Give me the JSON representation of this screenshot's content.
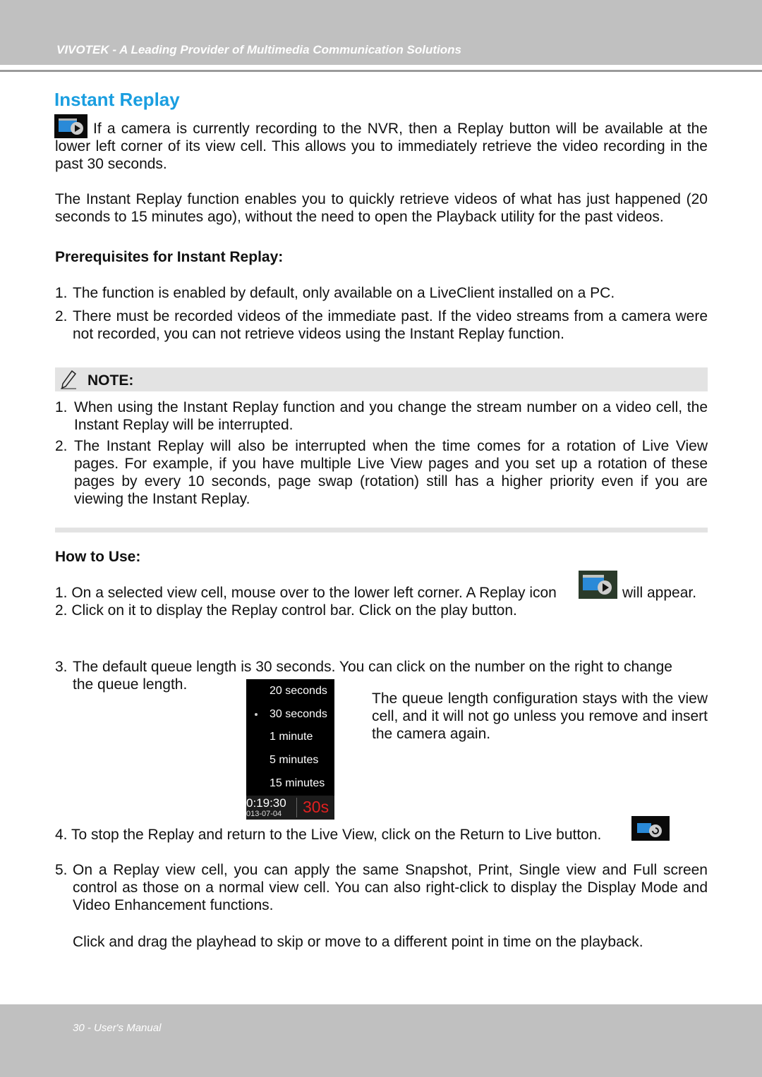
{
  "header": {
    "tagline": "VIVOTEK - A Leading Provider of Multimedia Communication Solutions"
  },
  "title": "Instant Replay",
  "intro": "If a camera is currently recording to the NVR, then a Replay button will be available at the lower left corner of its view cell. This allows you to immediately retrieve the video recording in the past 30 seconds.",
  "para2": "The Instant Replay function enables you to quickly retrieve videos of what has just happened (20 seconds to 15 minutes ago), without the need to open the Playback utility for the past videos.",
  "prereq": {
    "heading": "Prerequisites for Instant Replay:",
    "items": [
      {
        "n": "1.",
        "text": "The function is enabled by default, only available on a LiveClient installed on a PC."
      },
      {
        "n": "2.",
        "text": "There must be recorded videos of the immediate past. If the video streams from a camera were not recorded, you can not retrieve videos using the Instant Replay function."
      }
    ]
  },
  "note": {
    "label": "NOTE:",
    "items": [
      {
        "n": "1.",
        "text": "When using the Instant Replay function and you change the stream number on a video cell, the Instant Replay will be interrupted."
      },
      {
        "n": "2.",
        "text": "The Instant Replay will also be interrupted when the time comes for a rotation of Live View pages. For example, if you have multiple Live View pages and you set up a rotation of these pages by every 10 seconds, page swap (rotation) still has a higher priority even if you are viewing the Instant Replay."
      }
    ]
  },
  "howto": {
    "heading": "How to Use:",
    "step1a": "1. On a selected view cell, mouse over to the lower left corner. A Replay icon",
    "step1b": "will appear.",
    "step2": "2. Click on it to display the Replay control bar. Click on the play button.",
    "step3": {
      "n": "3.",
      "text": "The default queue length is 30 seconds. You can click on the number on the right to change the queue length."
    },
    "side": "The queue length configuration stays with the view cell, and it will not go unless you remove and insert the camera again.",
    "step4": "4. To stop the Replay and return to the Live View, click on the Return to Live button.",
    "step5": {
      "n": "5.",
      "text": "On a Replay view cell, you can apply the same Snapshot, Print, Single view and Full screen control as those on a normal view cell. You can also right-click to display the Display Mode and Video Enhancement functions."
    },
    "drag": "Click and drag the playhead to skip or move to a different point in time on the playback."
  },
  "queue_menu": {
    "options": [
      "20 seconds",
      "30 seconds",
      "1 minute",
      "5 minutes",
      "15 minutes"
    ],
    "selected": "30 seconds",
    "time": "0:19:30",
    "date": "013-07-04",
    "badge": "30s",
    "badge_color": "#e02020"
  },
  "footer": {
    "page": "30 - User's Manual"
  },
  "colors": {
    "title": "#1a9ee0",
    "band": "#c0c0c0"
  }
}
